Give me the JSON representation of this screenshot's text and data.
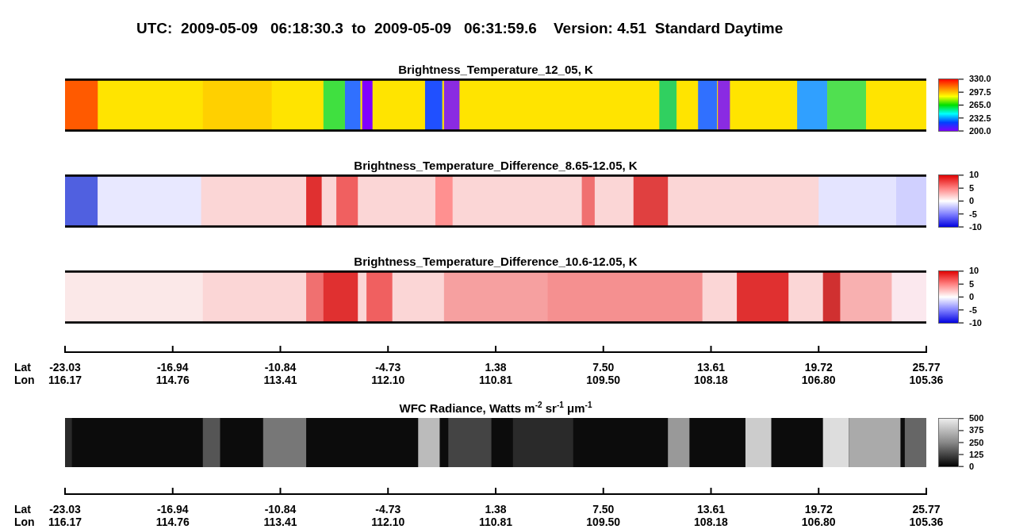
{
  "title": "UTC:  2009-05-09   06:18:30.3  to  2009-05-09   06:31:59.6    Version: 4.51  Standard Daytime",
  "sections": [
    {
      "kind": "rainbow",
      "title": "Brightness_Temperature_12_05, K",
      "colorbar_ticks": [
        "330.0",
        "297.5",
        "265.0",
        "232.5",
        "200.0"
      ]
    },
    {
      "kind": "diverging",
      "title": "Brightness_Temperature_Difference_8.65-12.05, K",
      "colorbar_ticks": [
        "10",
        "5",
        "0",
        "-5",
        "-10"
      ]
    },
    {
      "kind": "diverging",
      "title": "Brightness_Temperature_Difference_10.6-12.05, K",
      "colorbar_ticks": [
        "10",
        "5",
        "0",
        "-5",
        "-10"
      ]
    },
    {
      "kind": "axis",
      "rows": [
        {
          "label": "Lat",
          "ticks": [
            "-23.03",
            "-16.94",
            "-10.84",
            "-4.73",
            "1.38",
            "7.50",
            "13.61",
            "19.72",
            "25.77"
          ]
        },
        {
          "label": "Lon",
          "ticks": [
            "116.17",
            "114.76",
            "113.41",
            "112.10",
            "110.81",
            "109.50",
            "108.18",
            "106.80",
            "105.36"
          ]
        }
      ]
    },
    {
      "kind": "gray",
      "title": "WFC Radiance, Watts m$^{-2}$ sr$^{-1}$ μm$^{-1}$",
      "colorbar_ticks": [
        "500",
        "375",
        "250",
        "125",
        "0"
      ]
    },
    {
      "kind": "axis",
      "rows": [
        {
          "label": "Lat",
          "ticks": [
            "-23.03",
            "-16.94",
            "-10.84",
            "-4.73",
            "1.38",
            "7.50",
            "13.61",
            "19.72",
            "25.77"
          ]
        },
        {
          "label": "Lon",
          "ticks": [
            "116.17",
            "114.76",
            "113.41",
            "112.10",
            "110.81",
            "109.50",
            "108.18",
            "106.80",
            "105.36"
          ]
        }
      ]
    }
  ]
}
